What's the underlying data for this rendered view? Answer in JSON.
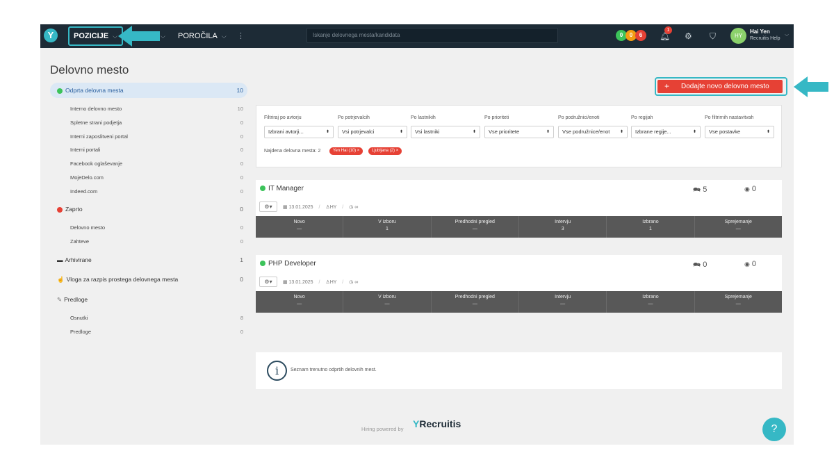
{
  "topbar": {
    "positions_label": "POZICIJE",
    "k_label": "K",
    "reports_label": "POROČILA",
    "more_label": "⋮",
    "search_placeholder": "Iskanje delovnega mesta/kandidata",
    "badges": [
      "0",
      "0",
      "6"
    ],
    "badge_colors": [
      "#3cc35a",
      "#f39c12",
      "#e64135"
    ],
    "notifications_count": "1",
    "user": {
      "initials": "HY",
      "name": "Hai Yen",
      "org": "Recruitis Help"
    }
  },
  "page": {
    "title": "Delovno mesto"
  },
  "sidebar": {
    "open": {
      "label": "Odprta delovna mesta",
      "count": "10"
    },
    "open_items": [
      {
        "label": "Interno delovno mesto",
        "count": "10"
      },
      {
        "label": "Spletne strani podjetja",
        "count": "0"
      },
      {
        "label": "Interni zaposlitveni portal",
        "count": "0"
      },
      {
        "label": "Interni portali",
        "count": "0"
      },
      {
        "label": "Facebook oglaševanje",
        "count": "0"
      },
      {
        "label": "MojeDelo.com",
        "count": "0"
      },
      {
        "label": "Indeed.com",
        "count": "0"
      }
    ],
    "closed": {
      "label": "Zaprto",
      "count": "0"
    },
    "closed_items": [
      {
        "label": "Delovno mesto",
        "count": "0"
      },
      {
        "label": "Zahteve",
        "count": "0"
      }
    ],
    "archived": {
      "label": "Arhivirane",
      "count": "1"
    },
    "simple_request": {
      "label": "Vloga za razpis prostega delovnega mesta",
      "count": "0"
    },
    "templates": {
      "label": "Predloge"
    },
    "template_items": [
      {
        "label": "Osnutki",
        "count": "8"
      },
      {
        "label": "Predloge",
        "count": "0"
      }
    ]
  },
  "main": {
    "add_button": "Dodajte novo delovno mesto",
    "filters": [
      {
        "label": "Filtriraj po avtorju",
        "value": "Izbrani avtorji..."
      },
      {
        "label": "Po potrjevalcih",
        "value": "Vsi potrjevalci"
      },
      {
        "label": "Po lastnikih",
        "value": "Vsi lastniki"
      },
      {
        "label": "Po prioriteti",
        "value": "Vse prioritete"
      },
      {
        "label": "Po podružnici/enoti",
        "value": "Vse podružnice/enot"
      },
      {
        "label": "Po regijah",
        "value": "Izbrane regije..."
      },
      {
        "label": "Po filtrirnih nastavitvah",
        "value": "Vse postavke"
      }
    ],
    "found_label": "Najdena delovna mesta: 2",
    "tags": [
      "Yen Hai (10) ×",
      "Ljubljana (2) ×"
    ],
    "jobs": [
      {
        "title": "IT Manager",
        "comments": "5",
        "views": "0",
        "date": "13.01.2025",
        "owner": "HY",
        "time": "∞",
        "stages": [
          {
            "name": "Novo",
            "value": "—"
          },
          {
            "name": "V izboru",
            "value": "1"
          },
          {
            "name": "Predhodni pregled",
            "value": "—"
          },
          {
            "name": "Intervju",
            "value": "3"
          },
          {
            "name": "Izbrano",
            "value": "1"
          },
          {
            "name": "Sprejemanje",
            "value": "—"
          }
        ]
      },
      {
        "title": "PHP Developer",
        "comments": "0",
        "views": "0",
        "date": "13.01.2025",
        "owner": "HY",
        "time": "∞",
        "stages": [
          {
            "name": "Novo",
            "value": "—"
          },
          {
            "name": "V izboru",
            "value": "—"
          },
          {
            "name": "Predhodni pregled",
            "value": "—"
          },
          {
            "name": "Intervju",
            "value": "—"
          },
          {
            "name": "Izbrano",
            "value": "—"
          },
          {
            "name": "Sprejemanje",
            "value": "—"
          }
        ]
      }
    ],
    "info_text": "Seznam trenutno odprtih delovnih mest."
  },
  "footer": {
    "powered_by": "Hiring powered by",
    "brand": "Recruitis",
    "help": "?"
  },
  "colors": {
    "accent": "#36b8c5",
    "danger": "#e64135",
    "nav_bg": "#1d2b36",
    "green": "#3cc35a"
  }
}
